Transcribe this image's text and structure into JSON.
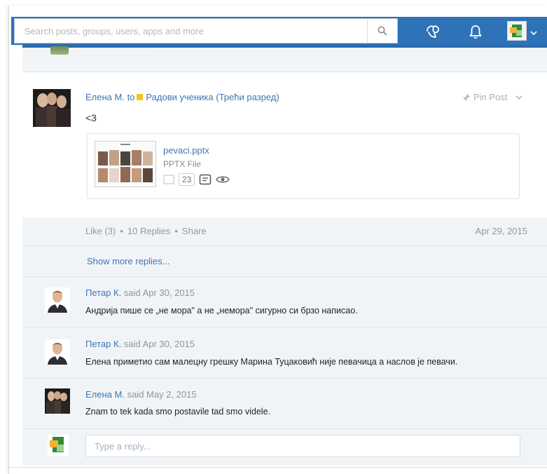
{
  "colors": {
    "brand_blue": "#2e73b8",
    "link_blue": "#3d76b5",
    "group_yellow": "#f5c518",
    "muted_text": "#8d99a6"
  },
  "header": {
    "search_placeholder": "Search posts, groups, users, apps and more",
    "icons": [
      "search-icon",
      "praise-icon",
      "bell-icon",
      "user-avatar",
      "chevron-down-icon"
    ]
  },
  "post": {
    "author": "Елена М.",
    "to_word": "to",
    "group": "Радови ученика (Трећи разред)",
    "pin_label": "Pin Post",
    "body": "<3",
    "attachment": {
      "name": "pevaci.pptx",
      "type": "PPTX File",
      "count": "23"
    },
    "actions": {
      "like": "Like (3)",
      "replies": "10 Replies",
      "share": "Share",
      "separator": "•"
    },
    "date": "Apr 29, 2015",
    "show_more": "Show more replies..."
  },
  "replies": [
    {
      "author": "Петар К.",
      "said": "said Apr 30, 2015",
      "text": "Андрија пише се „не мора\" а не „немора\" сигурно си брзо написао."
    },
    {
      "author": "Петар К.",
      "said": "said Apr 30, 2015",
      "text": "Елена приметио сам малецну грешку Марина Туцаковић није певачица а наслов је певачи."
    },
    {
      "author": "Елена М.",
      "said": "said May 2, 2015",
      "text": "Znam to tek kada smo postavile tad smo videle."
    }
  ],
  "reply_box": {
    "placeholder": "Type a reply..."
  }
}
